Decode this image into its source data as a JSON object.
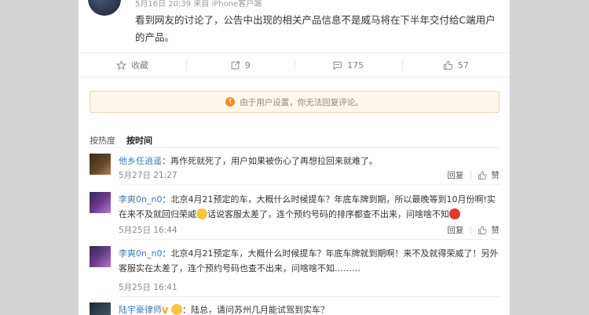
{
  "post": {
    "meta": "5月16日 20:39 来自 iPhone客户端",
    "text": "看到网友的讨论了，公告中出现的相关产品信息不是威马将在下半年交付给C端用户的产品。"
  },
  "actions": {
    "favorite": "收藏",
    "repost": "9",
    "comment": "175",
    "like": "57"
  },
  "notice": "由于用户设置，你无法回复评论。",
  "sort": {
    "hot": "按热度",
    "time": "按时间"
  },
  "comment_ops": {
    "reply": "回复",
    "like": "赞"
  },
  "comments": [
    {
      "user": "他乡任逍遥",
      "text": "：再作死就死了，用户如果被伤心了再想拉回来就难了。",
      "time": "5月27日 21:27"
    },
    {
      "user": "李爽0n_n0",
      "text_a": "：北京4月21预定的车，大概什么时候提车？年底车牌到期，所以最晚等到10月份啊!实在来不及就回归荣威",
      "text_b": "话说客服太差了，连个预约号码的排序都查不出来，问啥啥不知",
      "time": "5月25日 16:44"
    },
    {
      "user": "李爽0n_n0",
      "text": "：北京4月21预定车，大概什么时候提车？年底车牌就到期啊！来不及就得荣威了！另外客服实在太差了，连个预约号码也查不出来，问啥啥不知………",
      "time": "5月25日 16:41"
    },
    {
      "user": "陆宇豪律师",
      "badge": "V",
      "text": "：陆总，请问苏州几月能试驾到实车？"
    }
  ],
  "colors": {
    "link": "#3b7abb",
    "notice_bg": "#fdf6ea",
    "warn": "#f08a24"
  }
}
